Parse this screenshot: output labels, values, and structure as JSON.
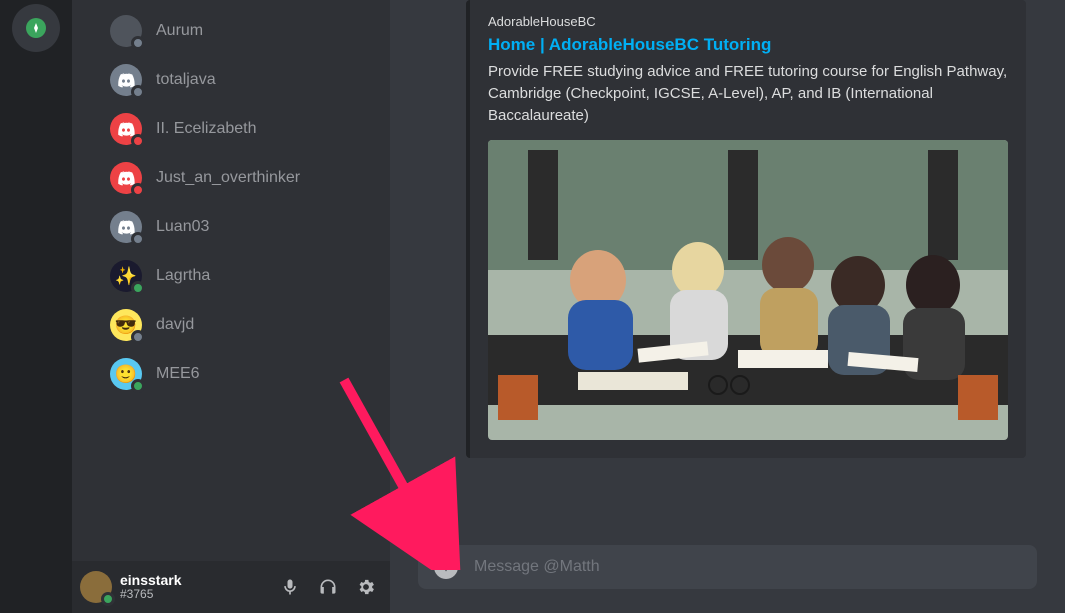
{
  "sidebar": {
    "server_icon": "compass-icon"
  },
  "members": [
    {
      "name": "Aurum",
      "status": "offline",
      "avatar_bg": "#4f545c",
      "emoji": ""
    },
    {
      "name": "totaljava",
      "status": "offline",
      "avatar_bg": "#747f8d",
      "emoji": "discord"
    },
    {
      "name": "II. Ecelizabeth",
      "status": "dnd",
      "avatar_bg": "#ed4245",
      "emoji": "discord"
    },
    {
      "name": "Just_an_overthinker",
      "status": "dnd",
      "avatar_bg": "#ed4245",
      "emoji": "discord"
    },
    {
      "name": "Luan03",
      "status": "offline",
      "avatar_bg": "#747f8d",
      "emoji": "discord"
    },
    {
      "name": "Lagrtha",
      "status": "online",
      "avatar_bg": "#1a1a2e",
      "emoji": "✨"
    },
    {
      "name": "davjd",
      "status": "offline",
      "avatar_bg": "#fee75c",
      "emoji": "😎"
    },
    {
      "name": "MEE6",
      "status": "online",
      "avatar_bg": "#59c8f1",
      "emoji": "🙂"
    }
  ],
  "user": {
    "name": "einsstark",
    "tag": "#3765",
    "status": "online",
    "avatar_bg": "#8a6d3b"
  },
  "embed": {
    "site": "AdorableHouseBC",
    "title": "Home | AdorableHouseBC Tutoring",
    "description": "Provide FREE studying advice and FREE tutoring course for English Pathway, Cambridge (Checkpoint, IGCSE, A-Level), AP, and IB (International Baccalaureate)"
  },
  "composer": {
    "placeholder": "Message @Matth"
  },
  "colors": {
    "link": "#00aff4",
    "arrow": "#ff1a5e"
  }
}
